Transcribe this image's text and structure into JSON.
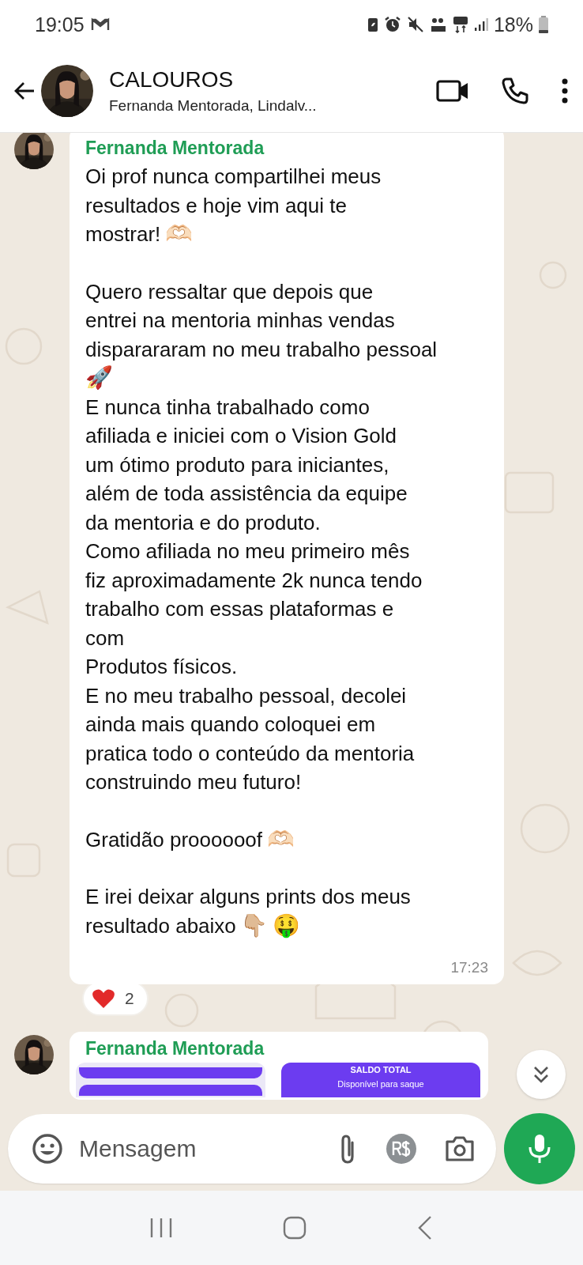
{
  "status_bar": {
    "time": "19:05",
    "battery": "18%"
  },
  "header": {
    "title": "CALOUROS",
    "subtitle": "Fernanda Mentorada, Lindalv..."
  },
  "messages": [
    {
      "kind": "text",
      "sender": "Fernanda Mentorada",
      "time": "17:23",
      "reaction": {
        "count": "2"
      },
      "paragraphs": [
        [
          {
            "text": "Oi prof nunca compartilhei meus"
          },
          {
            "text": "resultados e hoje vim aqui te"
          },
          {
            "text": "mostrar!",
            "emojis": [
              "🫶🏻"
            ]
          }
        ],
        [
          {
            "text": "Quero ressaltar que depois que"
          },
          {
            "text": "entrei na mentoria minhas vendas"
          },
          {
            "text": "disparararam no meu trabalho pessoal"
          },
          {
            "emojis": [
              "🚀"
            ]
          },
          {
            "text": "E nunca tinha trabalhado como"
          },
          {
            "text": "afiliada e iniciei com o Vision Gold"
          },
          {
            "text": "um ótimo produto para iniciantes,"
          },
          {
            "text": "além de toda assistência da equipe"
          },
          {
            "text": "da mentoria e do produto."
          },
          {
            "text": "Como afiliada no meu primeiro mês"
          },
          {
            "text": "fiz aproximadamente 2k nunca tendo"
          },
          {
            "text": "trabalho com essas plataformas e"
          },
          {
            "text": "com"
          },
          {
            "text": "Produtos físicos."
          },
          {
            "text": "E no meu trabalho pessoal, decolei"
          },
          {
            "text": "ainda mais quando coloquei em"
          },
          {
            "text": "pratica todo o conteúdo da mentoria"
          },
          {
            "text": "construindo meu futuro!"
          }
        ],
        [
          {
            "text": "Gratidão proooooof",
            "emojis": [
              "🫶🏻"
            ]
          }
        ],
        [
          {
            "text": "E irei deixar alguns prints dos meus"
          },
          {
            "text": "resultado abaixo",
            "emojis": [
              "👇🏼",
              "🤑"
            ]
          }
        ]
      ]
    },
    {
      "kind": "images",
      "sender": "Fernanda Mentorada",
      "card": {
        "title": "SALDO TOTAL",
        "subtitle": "Disponível para saque"
      }
    }
  ],
  "composer": {
    "placeholder": "Mensagem"
  }
}
